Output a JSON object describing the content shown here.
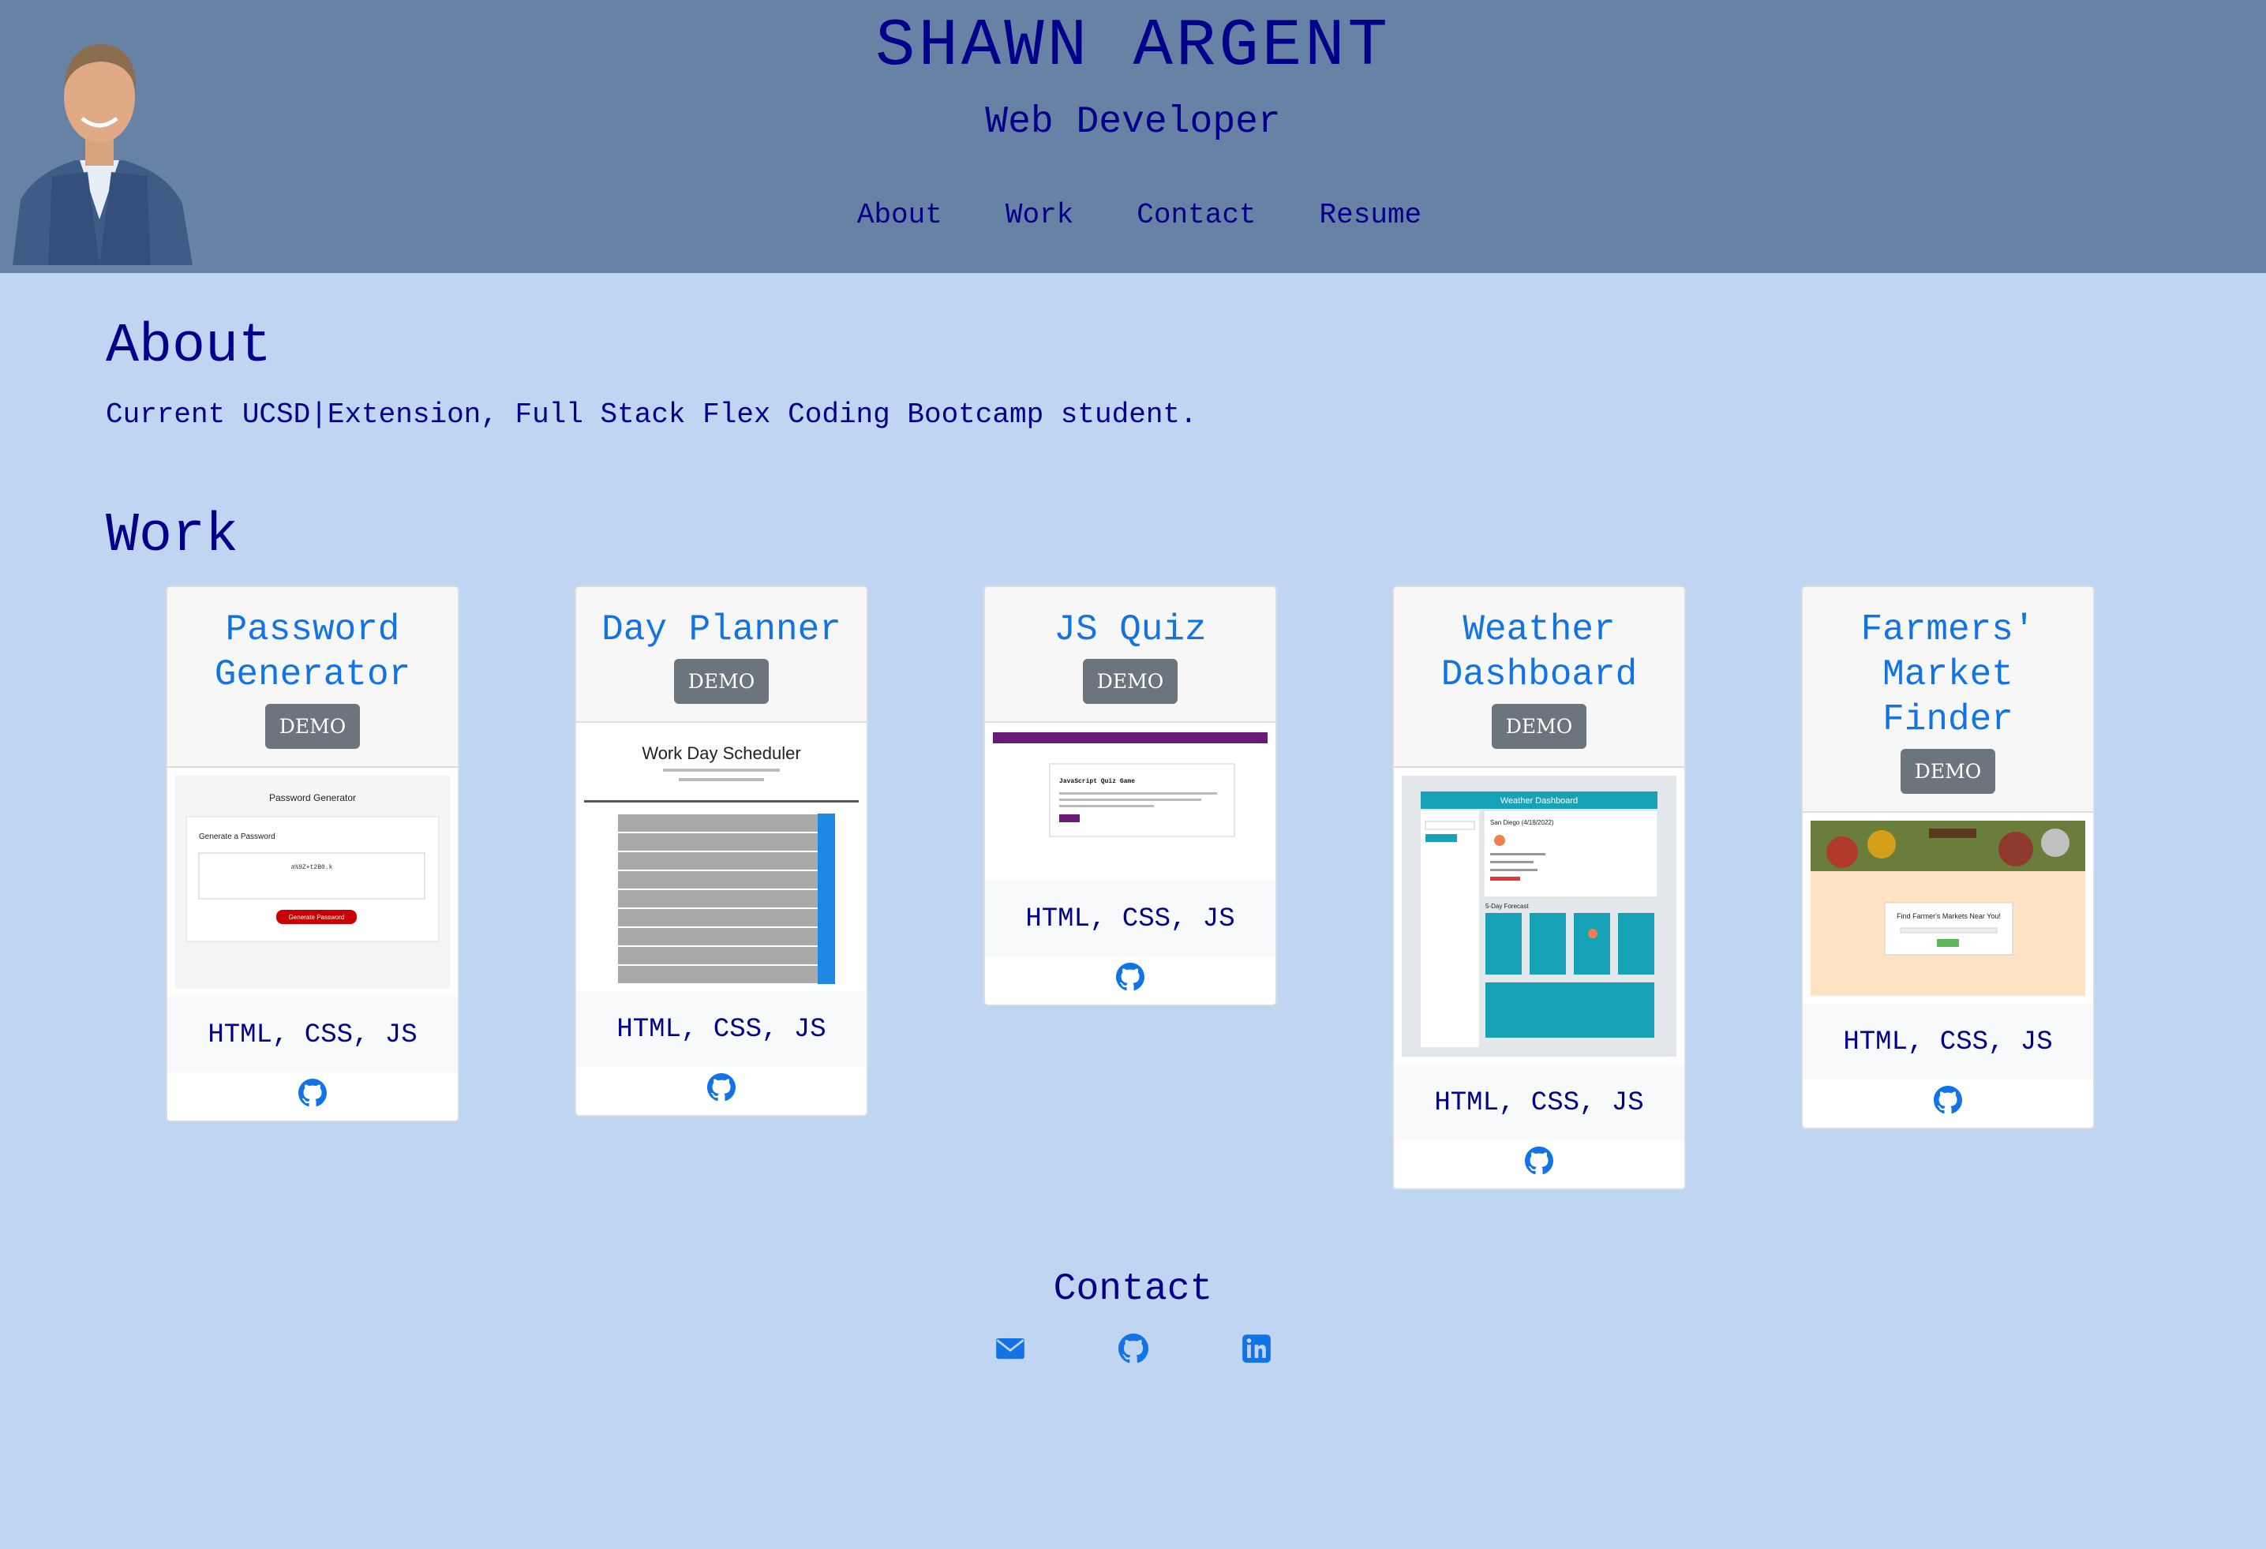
{
  "header": {
    "name": "SHAWN ARGENT",
    "subtitle": "Web Developer",
    "nav": [
      "About",
      "Work",
      "Contact",
      "Resume"
    ]
  },
  "about": {
    "heading": "About",
    "text": "Current UCSD|Extension, Full Stack Flex Coding Bootcamp student."
  },
  "work": {
    "heading": "Work",
    "projects": [
      {
        "title": "Password Generator",
        "demo": "DEMO",
        "tech": "HTML, CSS, JS",
        "preview": {
          "heading": "Password Generator",
          "subheading": "Generate a Password",
          "value": "a%9Z+t2B0.k",
          "button": "Generate Password"
        }
      },
      {
        "title": "Day Planner",
        "demo": "DEMO",
        "tech": "HTML, CSS, JS",
        "preview": {
          "heading": "Work Day Scheduler"
        }
      },
      {
        "title": "JS Quiz",
        "demo": "DEMO",
        "tech": "HTML, CSS, JS",
        "preview": {
          "heading": "JavaScript Quiz Game"
        }
      },
      {
        "title": "Weather Dashboard",
        "demo": "DEMO",
        "tech": "HTML, CSS, JS",
        "preview": {
          "heading": "Weather Dashboard",
          "city": "San Diego (4/18/2022)",
          "forecast": "5-Day Forecast"
        }
      },
      {
        "title": "Farmers' Market Finder",
        "demo": "DEMO",
        "tech": "HTML, CSS, JS",
        "preview": {
          "heading": "Find Farmer's Markets Near You!"
        }
      }
    ]
  },
  "contact": {
    "heading": "Contact",
    "icons": [
      "envelope-icon",
      "github-icon",
      "linkedin-icon"
    ]
  },
  "colors": {
    "header_bg": "#6882a6",
    "page_bg": "#bfd5f1",
    "text": "#00008b",
    "link": "#1273e6",
    "button": "#6c757d"
  }
}
